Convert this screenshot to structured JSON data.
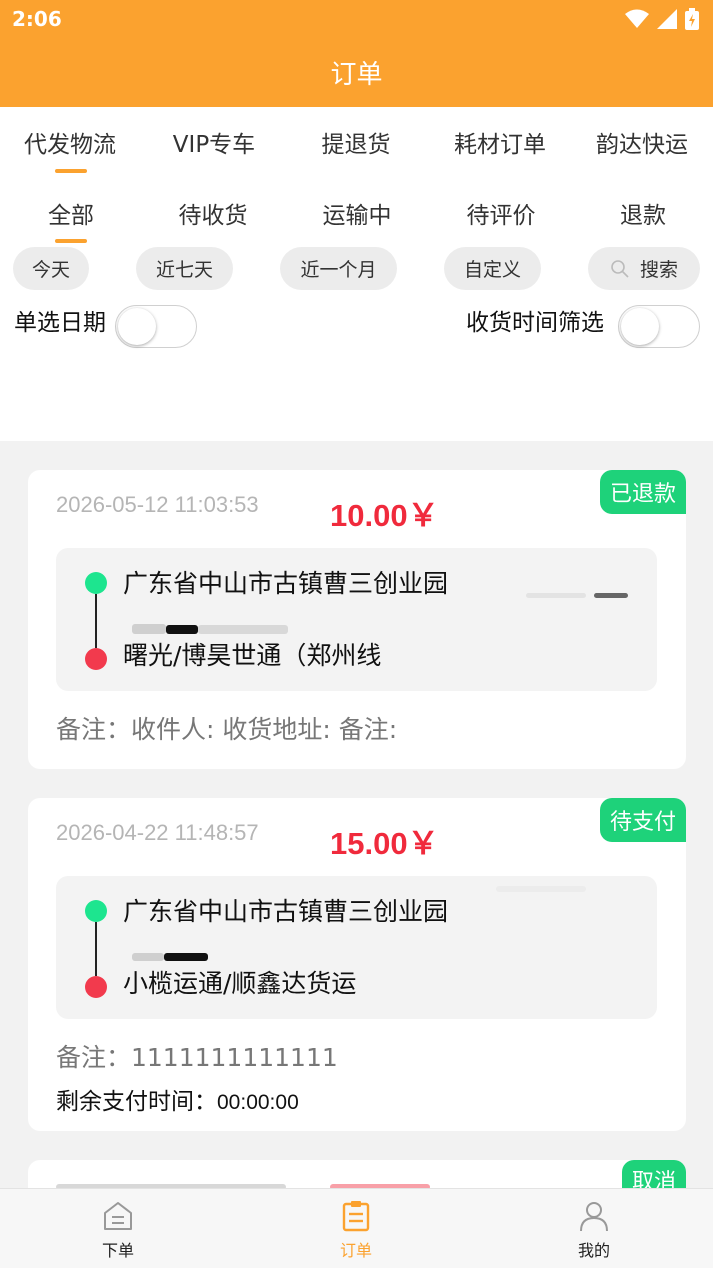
{
  "status_bar": {
    "time": "2:06"
  },
  "header": {
    "title": "订单"
  },
  "category_tabs": [
    {
      "label": "代发物流",
      "active": true
    },
    {
      "label": "VIP专车",
      "active": false
    },
    {
      "label": "提退货",
      "active": false
    },
    {
      "label": "耗材订单",
      "active": false
    },
    {
      "label": "韵达快运",
      "active": false
    }
  ],
  "status_tabs": [
    {
      "label": "全部",
      "active": true
    },
    {
      "label": "待收货",
      "active": false
    },
    {
      "label": "运输中",
      "active": false
    },
    {
      "label": "待评价",
      "active": false
    },
    {
      "label": "退款",
      "active": false
    }
  ],
  "date_filters": [
    "今天",
    "近七天",
    "近一个月",
    "自定义"
  ],
  "search": {
    "label": "搜索"
  },
  "toggles": {
    "single_date": {
      "label": "单选日期",
      "on": false
    },
    "receive_time": {
      "label": "收货时间筛选",
      "on": false
    }
  },
  "orders": [
    {
      "status": "已退款",
      "time": "2026-05-12 11:03:53",
      "price": "10.00￥",
      "from": "广东省中山市古镇曹三创业园",
      "to": "曙光/博昊世通（郑州线",
      "remark": "备注：收件人: 收货地址: 备注:"
    },
    {
      "status": "待支付",
      "time": "2026-04-22 11:48:57",
      "price": "15.00￥",
      "from": "广东省中山市古镇曹三创业园",
      "to": "小榄运通/顺鑫达货运",
      "remark": "备注：1111111111111",
      "pay_label": "剩余支付时间：",
      "pay_time": "00:00:00"
    },
    {
      "status": "取消"
    }
  ],
  "bottom_nav": [
    {
      "label": "下单",
      "icon": "home-icon",
      "active": false
    },
    {
      "label": "订单",
      "icon": "order-list-icon",
      "active": true
    },
    {
      "label": "我的",
      "icon": "profile-icon",
      "active": false
    }
  ],
  "colors": {
    "accent": "#fba22f",
    "badge": "#1ed27a",
    "price": "#f02a3c"
  }
}
